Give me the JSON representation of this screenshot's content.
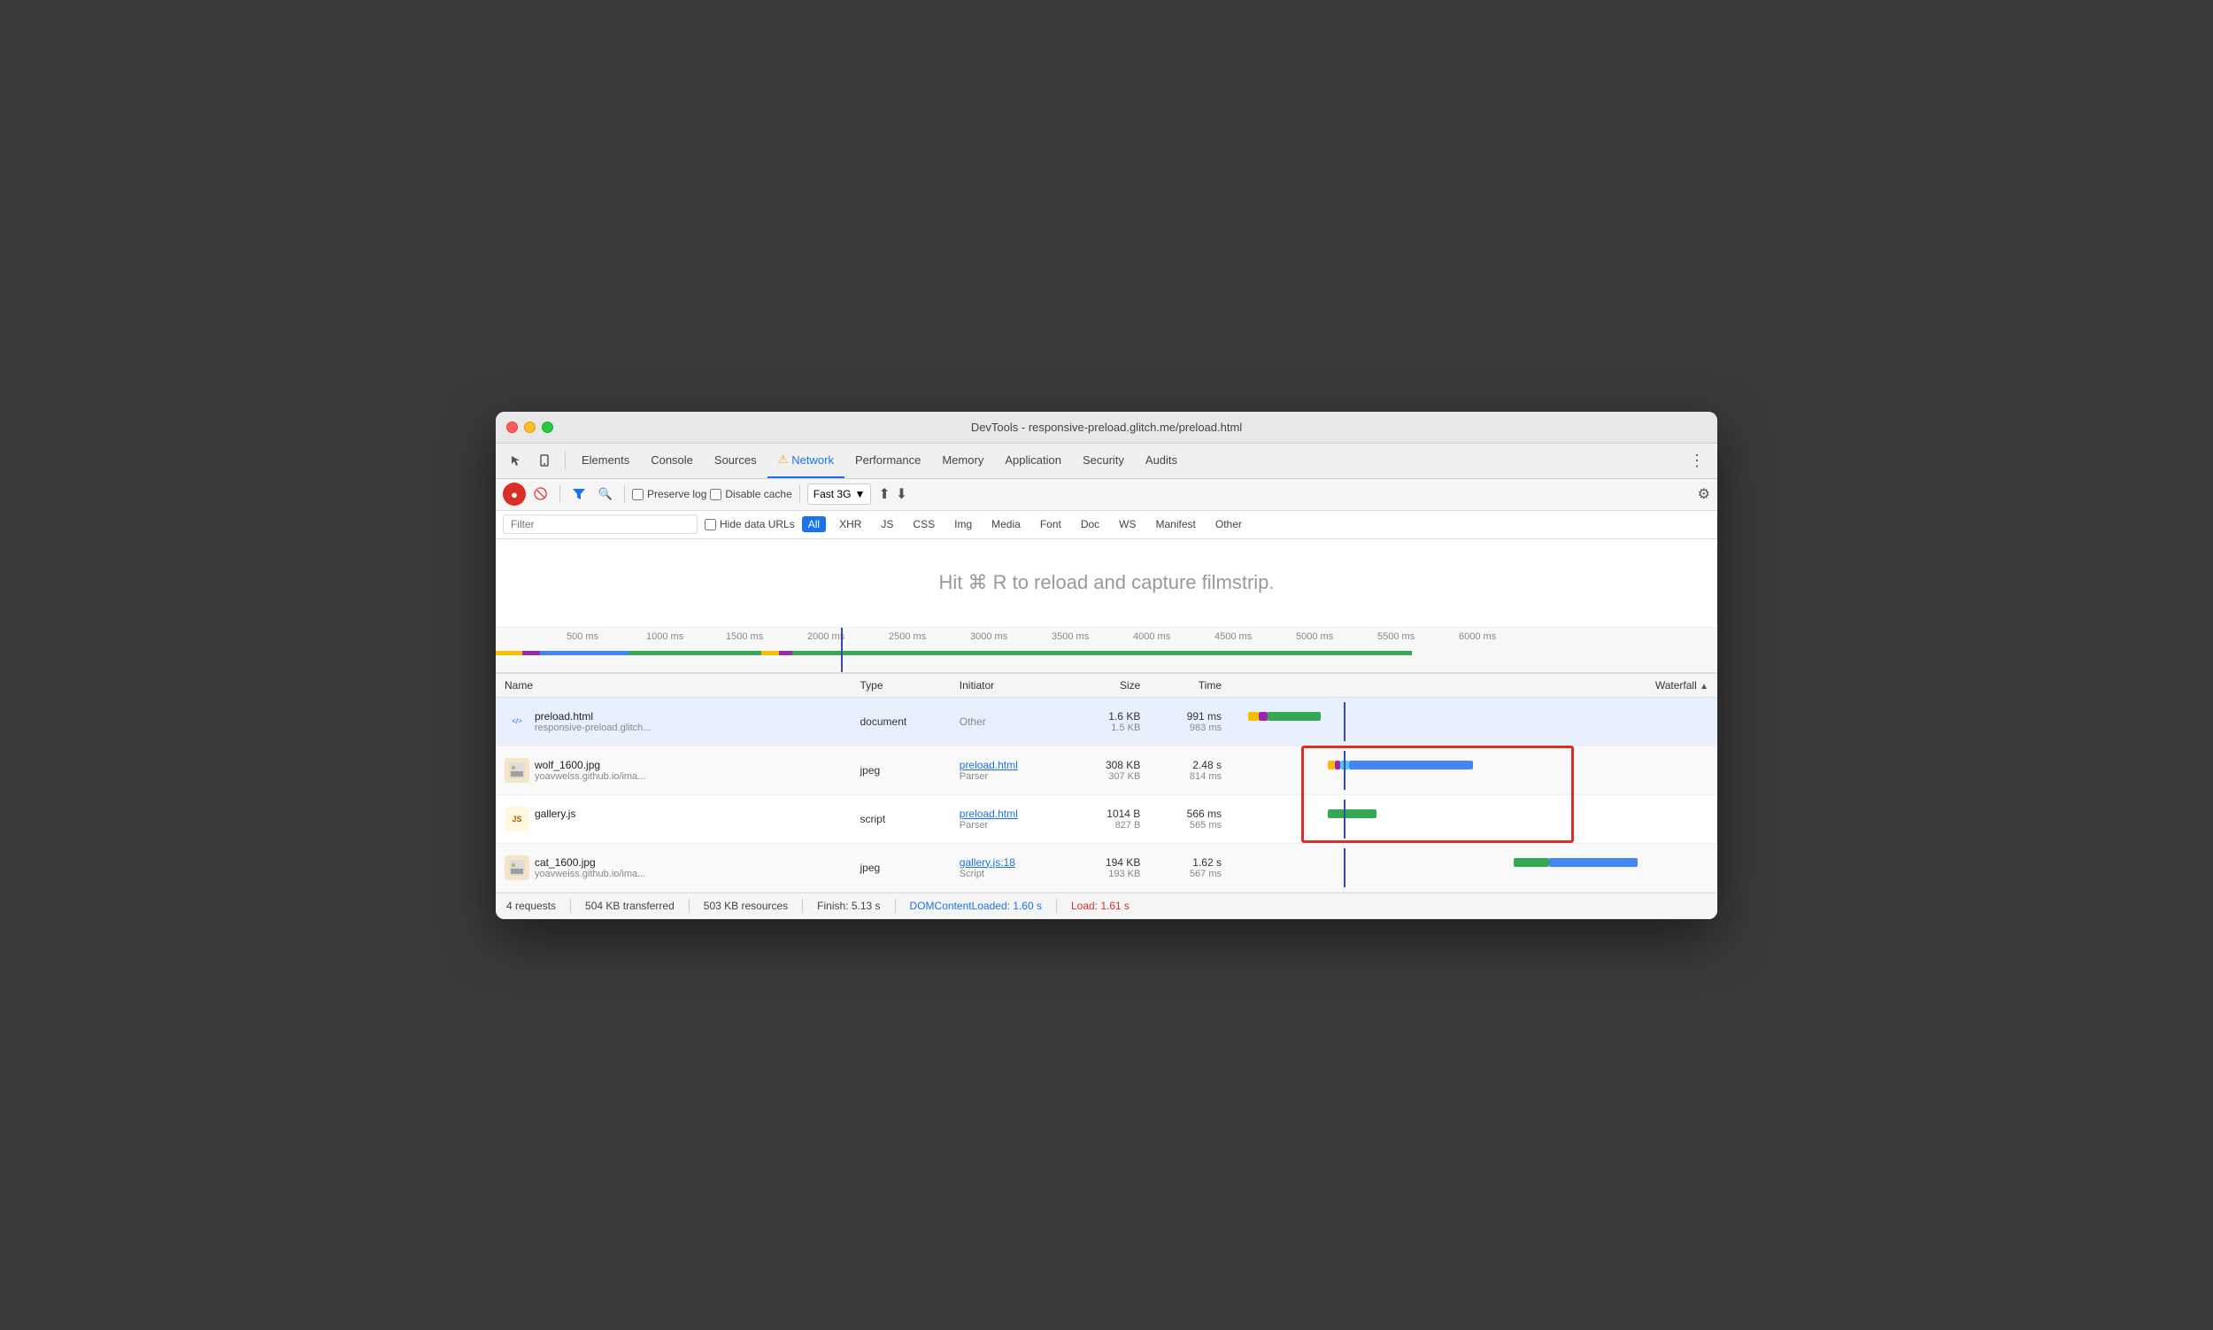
{
  "window": {
    "title": "DevTools - responsive-preload.glitch.me/preload.html",
    "traffic_lights": [
      "red",
      "yellow",
      "green"
    ]
  },
  "tabs": {
    "items": [
      {
        "label": "Elements",
        "active": false
      },
      {
        "label": "Console",
        "active": false
      },
      {
        "label": "Sources",
        "active": false
      },
      {
        "label": "Network",
        "active": true,
        "warning": "⚠"
      },
      {
        "label": "Performance",
        "active": false
      },
      {
        "label": "Memory",
        "active": false
      },
      {
        "label": "Application",
        "active": false
      },
      {
        "label": "Security",
        "active": false
      },
      {
        "label": "Audits",
        "active": false
      }
    ]
  },
  "toolbar": {
    "preserve_log": "Preserve log",
    "disable_cache": "Disable cache",
    "throttle": "Fast 3G",
    "settings_tooltip": "Settings"
  },
  "filter": {
    "placeholder": "Filter",
    "hide_data_urls": "Hide data URLs",
    "types": [
      "All",
      "XHR",
      "JS",
      "CSS",
      "Img",
      "Media",
      "Font",
      "Doc",
      "WS",
      "Manifest",
      "Other"
    ],
    "active_type": "All"
  },
  "filmstrip": {
    "hint": "Hit ⌘ R to reload and capture filmstrip."
  },
  "timeline": {
    "ticks": [
      "500 ms",
      "1000 ms",
      "1500 ms",
      "2000 ms",
      "2500 ms",
      "3000 ms",
      "3500 ms",
      "4000 ms",
      "4500 ms",
      "5000 ms",
      "5500 ms",
      "6000 ms"
    ]
  },
  "table": {
    "headers": [
      "Name",
      "Type",
      "Initiator",
      "Size",
      "Time",
      "Waterfall"
    ],
    "rows": [
      {
        "icon_type": "html",
        "icon_label": "</>",
        "name": "preload.html",
        "name_sub": "responsive-preload.glitch...",
        "type": "document",
        "initiator": "Other",
        "initiator_link": false,
        "size": "1.6 KB",
        "size_sub": "1.5 KB",
        "time": "991 ms",
        "time_sub": "983 ms",
        "selected": true
      },
      {
        "icon_type": "jpeg",
        "icon_label": "🖼",
        "name": "wolf_1600.jpg",
        "name_sub": "yoavweiss.github.io/ima...",
        "type": "jpeg",
        "initiator": "preload.html",
        "initiator_link": true,
        "initiator_sub": "Parser",
        "size": "308 KB",
        "size_sub": "307 KB",
        "time": "2.48 s",
        "time_sub": "814 ms",
        "selected": false
      },
      {
        "icon_type": "js",
        "icon_label": "JS",
        "name": "gallery.js",
        "name_sub": "",
        "type": "script",
        "initiator": "preload.html",
        "initiator_link": true,
        "initiator_sub": "Parser",
        "size": "1014 B",
        "size_sub": "827 B",
        "time": "566 ms",
        "time_sub": "565 ms",
        "selected": false
      },
      {
        "icon_type": "jpeg",
        "icon_label": "🖼",
        "name": "cat_1600.jpg",
        "name_sub": "yoavweiss.github.io/ima...",
        "type": "jpeg",
        "initiator": "gallery.js:18",
        "initiator_link": true,
        "initiator_sub": "Script",
        "size": "194 KB",
        "size_sub": "193 KB",
        "time": "1.62 s",
        "time_sub": "567 ms",
        "selected": false
      }
    ]
  },
  "status_bar": {
    "requests": "4 requests",
    "transferred": "504 KB transferred",
    "resources": "503 KB resources",
    "finish": "Finish: 5.13 s",
    "dom_content_loaded": "DOMContentLoaded: 1.60 s",
    "load": "Load: 1.61 s"
  }
}
